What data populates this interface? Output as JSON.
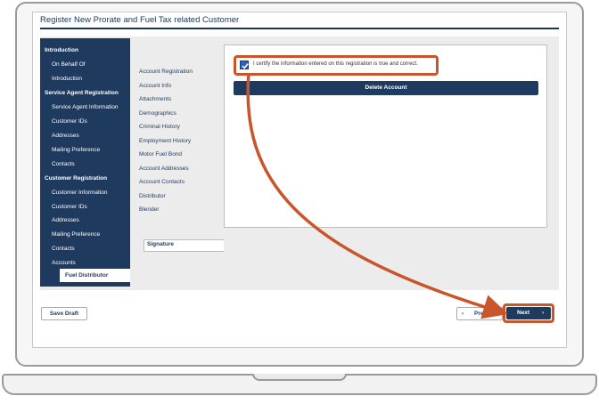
{
  "window": {
    "title": "Register New Prorate and Fuel Tax related Customer"
  },
  "left_nav": [
    {
      "label": "Introduction",
      "type": "head"
    },
    {
      "label": "On Behalf Of",
      "type": "sub"
    },
    {
      "label": "Introduction",
      "type": "sub"
    },
    {
      "label": "Service Agent Registration",
      "type": "head"
    },
    {
      "label": "Service Agent Information",
      "type": "sub"
    },
    {
      "label": "Customer IDs",
      "type": "sub"
    },
    {
      "label": "Addresses",
      "type": "sub"
    },
    {
      "label": "Mailing Preference",
      "type": "sub"
    },
    {
      "label": "Contacts",
      "type": "sub"
    },
    {
      "label": "Customer Registration",
      "type": "head"
    },
    {
      "label": "Customer Information",
      "type": "sub"
    },
    {
      "label": "Customer IDs",
      "type": "sub"
    },
    {
      "label": "Addresses",
      "type": "sub"
    },
    {
      "label": "Mailing Preference",
      "type": "sub"
    },
    {
      "label": "Contacts",
      "type": "sub"
    },
    {
      "label": "Accounts",
      "type": "sub"
    },
    {
      "label": "Fuel Distributor",
      "type": "active"
    }
  ],
  "tabs": [
    "Account Registration",
    "Account Info",
    "Attachments",
    "Demographics",
    "Criminal History",
    "Employment History",
    "Motor Fuel Bond",
    "Account Addresses",
    "Account Contacts",
    "Distributor",
    "Blender"
  ],
  "active_tab": "Signature",
  "certification": {
    "checked": true,
    "text": "I certify the information entered on this registration is true and correct."
  },
  "buttons": {
    "delete_account": "Delete Account",
    "save_draft": "Save Draft",
    "previous": "Previous",
    "next": "Next",
    "prev_chevron": "‹",
    "next_chevron": "›"
  },
  "colors": {
    "primary": "#1f3a5f",
    "highlight": "#c8562a",
    "checkbox": "#2b62c7"
  }
}
